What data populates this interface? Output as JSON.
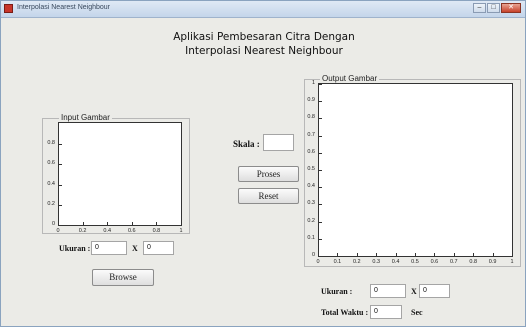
{
  "window": {
    "title": "Interpolasi Nearest Neighbour",
    "min_glyph": "‒",
    "max_glyph": "□",
    "close_glyph": "✕"
  },
  "heading": {
    "line1": "Aplikasi Pembesaran Citra Dengan",
    "line2": "Interpolasi Nearest Neighbour"
  },
  "input_panel": {
    "title": "Input Gambar",
    "y_ticks": [
      "0.8",
      "0.6",
      "0.4",
      "0.2",
      "0"
    ],
    "x_ticks": [
      "0",
      "0.2",
      "0.4",
      "0.6",
      "0.8",
      "1"
    ],
    "ukuran_label": "Ukuran :",
    "width_value": "0",
    "x_label": "X",
    "height_value": "0",
    "browse_label": "Browse"
  },
  "controls": {
    "skala_label": "Skala :",
    "skala_value": "",
    "proses_label": "Proses",
    "reset_label": "Reset"
  },
  "output_panel": {
    "title": "Output Gambar",
    "y_ticks": [
      "1",
      "0.9",
      "0.8",
      "0.7",
      "0.6",
      "0.5",
      "0.4",
      "0.3",
      "0.2",
      "0.1",
      "0"
    ],
    "x_ticks": [
      "0",
      "0.1",
      "0.2",
      "0.3",
      "0.4",
      "0.5",
      "0.6",
      "0.7",
      "0.8",
      "0.9",
      "1"
    ],
    "ukuran_label": "Ukuran :",
    "width_value": "0",
    "x_label": "X",
    "height_value": "0",
    "waktu_label": "Total Waktu :",
    "waktu_value": "0",
    "sec_label": "Sec"
  }
}
